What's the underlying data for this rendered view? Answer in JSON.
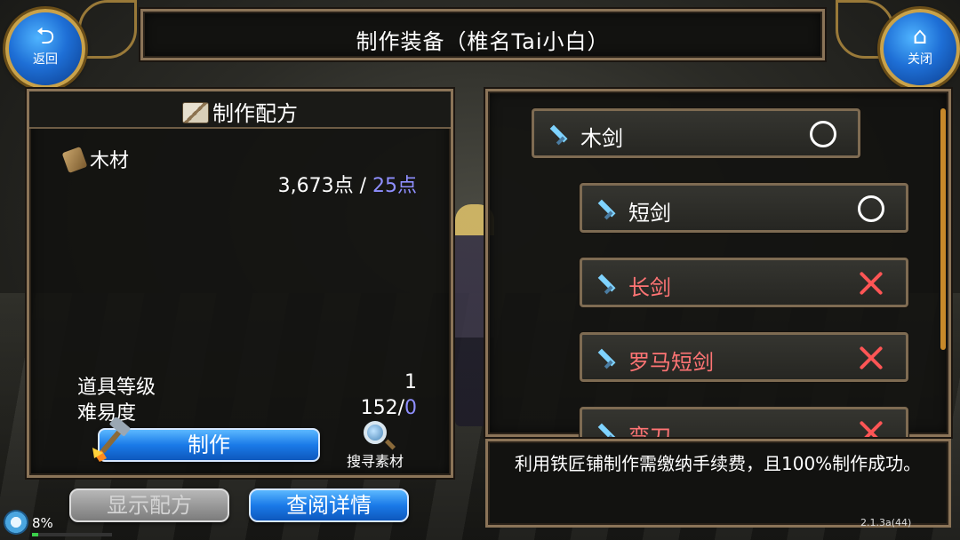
{
  "window": {
    "title": "制作装备（椎名Tai小白）"
  },
  "nav": {
    "back_label": "返回",
    "close_label": "关闭"
  },
  "recipe": {
    "header": "制作配方",
    "material_name": "木材",
    "points_owned": "3,673点",
    "points_separator": " / ",
    "points_cost": "25点",
    "item_level_label": "道具等级",
    "item_level_value": "1",
    "difficulty_label": "难易度",
    "difficulty_value": "152/",
    "difficulty_bonus": "0",
    "make_label": "制作",
    "search_label": "搜寻素材"
  },
  "bottom_buttons": {
    "show_recipe": "显示配方",
    "details": "查阅详情"
  },
  "items": [
    {
      "name": "木剑",
      "status": "available"
    },
    {
      "name": "短剑",
      "status": "available"
    },
    {
      "name": "长剑",
      "status": "unavailable"
    },
    {
      "name": "罗马短剑",
      "status": "unavailable"
    },
    {
      "name": "弯刀",
      "status": "unavailable"
    }
  ],
  "description": "利用铁匠铺制作需缴纳手续费，且100%制作成功。",
  "status_bar": {
    "percent": "8%",
    "progress": 0.08,
    "version": "2.1.3a(44)"
  },
  "colors": {
    "cost_blue": "#8f8fff",
    "unavailable_red": "#ff7474",
    "button_blue": "#1a7ae8",
    "frame_brown": "#8b7458"
  },
  "icons": {
    "back": "return-arrow-icon",
    "close": "house-icon",
    "sword": "sword-icon",
    "wood": "wood-log-icon",
    "book": "book-icon",
    "hammer": "hammer-icon",
    "search": "magnifier-icon"
  }
}
